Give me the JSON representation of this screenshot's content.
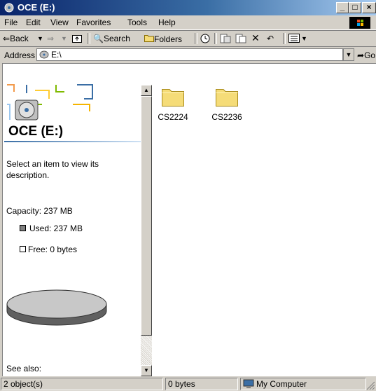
{
  "window": {
    "title": "OCE (E:)",
    "icon": "drive-icon",
    "caption_buttons": [
      "minimize",
      "maximize",
      "close"
    ]
  },
  "menubar": {
    "items": [
      "File",
      "Edit",
      "View",
      "Favorites",
      "Tools",
      "Help"
    ]
  },
  "toolbar": {
    "back_label": "Back",
    "search_label": "Search",
    "folders_label": "Folders"
  },
  "address": {
    "label": "Address",
    "value": "E:\\",
    "go_label": "Go"
  },
  "left_pane": {
    "drive_title": "OCE (E:)",
    "description": "Select an item to view its description.",
    "capacity": "Capacity: 237 MB",
    "used": "Used: 237 MB",
    "free": "Free: 0 bytes",
    "see_also": "See also:"
  },
  "folders": [
    {
      "name": "CS2224"
    },
    {
      "name": "CS2236"
    }
  ],
  "statusbar": {
    "objects": "2 object(s)",
    "size": "0 bytes",
    "zone": "My Computer"
  },
  "colors": {
    "titlebar_start": "#0a246a",
    "titlebar_end": "#a6caf0",
    "chrome": "#d4d0c8",
    "folder": "#f5dc78"
  }
}
